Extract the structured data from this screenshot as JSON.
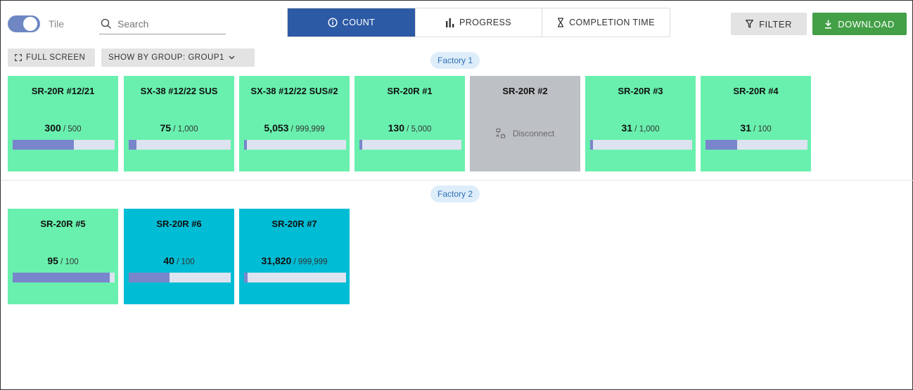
{
  "toolbar": {
    "tile_label": "Tile",
    "search_placeholder": "Search",
    "tabs": [
      {
        "label": "COUNT",
        "icon": "info-circle-icon",
        "active": true
      },
      {
        "label": "PROGRESS",
        "icon": "bar-chart-icon",
        "active": false
      },
      {
        "label": "COMPLETION TIME",
        "icon": "hourglass-icon",
        "active": false
      }
    ],
    "filter_label": "FILTER",
    "download_label": "DOWNLOAD",
    "fullscreen_label": "FULL SCREEN",
    "group_label": "SHOW BY GROUP: GROUP1"
  },
  "colors": {
    "accent": "#2d5aa5",
    "download": "#43a047",
    "tile_green": "#69f0ae",
    "tile_cyan": "#00bcd4",
    "tile_gray": "#bdc0c4",
    "bar_fill": "#7986cb"
  },
  "groups": [
    {
      "name": "Factory 1",
      "tiles": [
        {
          "name": "SR-20R #12/21",
          "count": "300",
          "total": "500",
          "progress": 0.6,
          "status": "green"
        },
        {
          "name": "SX-38 #12/22 SUS",
          "count": "75",
          "total": "1,000",
          "progress": 0.075,
          "status": "green"
        },
        {
          "name": "SX-38 #12/22 SUS#2",
          "count": "5,053",
          "total": "999,999",
          "progress": 0.005,
          "status": "green"
        },
        {
          "name": "SR-20R #1",
          "count": "130",
          "total": "5,000",
          "progress": 0.026,
          "status": "green"
        },
        {
          "name": "SR-20R #2",
          "disconnect": "Disconnect",
          "status": "gray"
        },
        {
          "name": "SR-20R #3",
          "count": "31",
          "total": "1,000",
          "progress": 0.031,
          "status": "green"
        },
        {
          "name": "SR-20R #4",
          "count": "31",
          "total": "100",
          "progress": 0.31,
          "status": "green"
        }
      ]
    },
    {
      "name": "Factory 2",
      "tiles": [
        {
          "name": "SR-20R #5",
          "count": "95",
          "total": "100",
          "progress": 0.95,
          "status": "green"
        },
        {
          "name": "SR-20R #6",
          "count": "40",
          "total": "100",
          "progress": 0.4,
          "status": "cyan"
        },
        {
          "name": "SR-20R #7",
          "count": "31,820",
          "total": "999,999",
          "progress": 0.032,
          "status": "cyan"
        }
      ]
    }
  ]
}
